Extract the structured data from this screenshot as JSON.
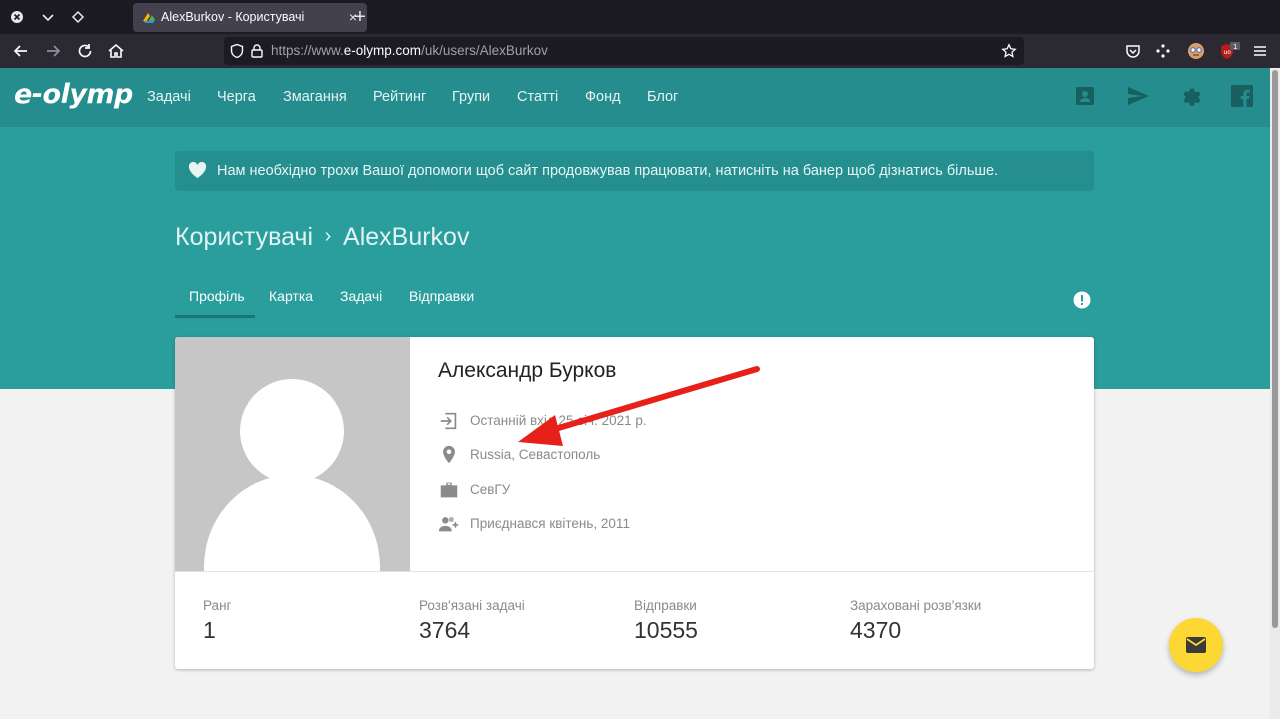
{
  "browser": {
    "tab_title": "AlexBurkov - Користувачі",
    "url_prefix": "https://www.",
    "url_host": "e-olymp.com",
    "url_path": "/uk/users/AlexBurkov",
    "ublock_badge": "1",
    "ublock_label": "uo"
  },
  "site": {
    "logo": "e-olymp",
    "nav": [
      "Задачі",
      "Черга",
      "Змагання",
      "Рейтинг",
      "Групи",
      "Статті",
      "Фонд",
      "Блог"
    ],
    "header_icons": [
      "account-box-icon",
      "send-icon",
      "settings-icon",
      "facebook-icon"
    ]
  },
  "banner": {
    "text": "Нам необхідно трохи Вашої допомоги щоб сайт продовжував працювати, натисніть на банер щоб дізнатись більше."
  },
  "breadcrumb": {
    "parent": "Користувачі",
    "separator": "›",
    "current": "AlexBurkov"
  },
  "profile_tabs": {
    "active": "Профіль",
    "items": [
      "Профіль",
      "Картка",
      "Задачі",
      "Відправки"
    ]
  },
  "profile": {
    "full_name": "Александр Бурков",
    "last_login": "Останній вхід 25 січ. 2021 р.",
    "location": "Russia, Севастополь",
    "organization": "СевГУ",
    "joined": "Приєднався квітень, 2011"
  },
  "stats": [
    {
      "label": "Ранг",
      "value": "1"
    },
    {
      "label": "Розв'язані задачі",
      "value": "3764"
    },
    {
      "label": "Відправки",
      "value": "10555"
    },
    {
      "label": "Зараховані розв'язки",
      "value": "4370"
    }
  ],
  "colors": {
    "header": "#258d8d",
    "band": "#2a9d9d",
    "fab": "#fdd835",
    "annotation_arrow": "#e8201a"
  }
}
